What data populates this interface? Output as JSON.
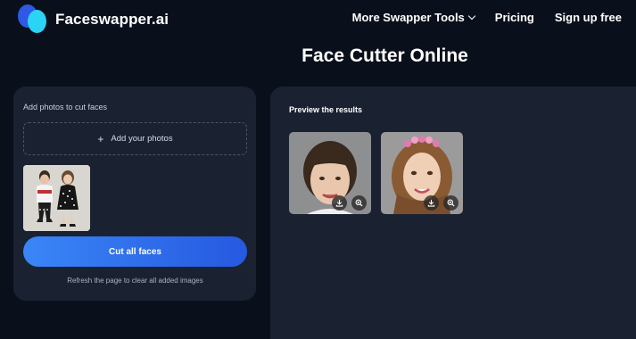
{
  "header": {
    "logo_text": "Faceswapper.ai",
    "nav": [
      {
        "label": "More Swapper Tools",
        "has_dropdown": true
      },
      {
        "label": "Pricing"
      },
      {
        "label": "Sign up free"
      }
    ]
  },
  "title": "Face Cutter Online",
  "upload_panel": {
    "label": "Add photos to cut faces",
    "add_button": "Add your photos",
    "cut_button": "Cut all faces",
    "hint": "Refresh the page to clear all added images"
  },
  "results_panel": {
    "label": "Preview the results",
    "results": [
      {
        "icons": [
          "download-icon",
          "zoom-icon"
        ]
      },
      {
        "icons": [
          "download-icon",
          "zoom-icon"
        ]
      }
    ]
  },
  "colors": {
    "background": "#0a101b",
    "panel": "#1a2232",
    "button_gradient_start": "#3a86f7",
    "button_gradient_end": "#2659e0",
    "logo_blue": "#2f58e6",
    "logo_cyan": "#2ad4f5"
  }
}
